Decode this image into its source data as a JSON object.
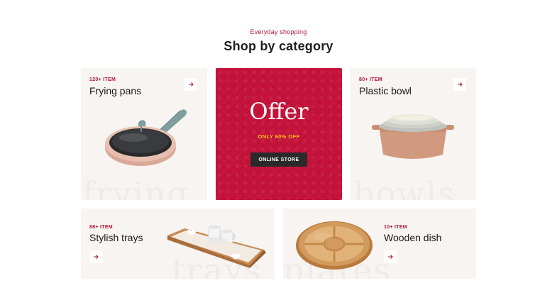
{
  "header": {
    "eyebrow": "Everyday shopping",
    "title": "Shop by category"
  },
  "cards": {
    "frying": {
      "count": "120+ ITEM",
      "name": "Frying pans",
      "bg_word": "frying"
    },
    "offer": {
      "title": "Offer",
      "subtitle": "ONLY 60% OFF",
      "button": "ONLINE STORE"
    },
    "bowl": {
      "count": "80+ ITEM",
      "name": "Plastic bowl",
      "bg_word": "bowls"
    },
    "trays": {
      "count": "88+ ITEM",
      "name": "Stylish trays",
      "bg_word": "trays"
    },
    "wooden": {
      "count": "10+ ITEM",
      "name": "Wooden dish",
      "bg_word": "plates"
    }
  },
  "colors": {
    "accent": "#b01535",
    "offer_bg": "#c8143c",
    "offer_sub": "#f5c518",
    "card_bg": "#f7f4f1"
  },
  "icons": {
    "arrow": "arrow-right-icon"
  }
}
